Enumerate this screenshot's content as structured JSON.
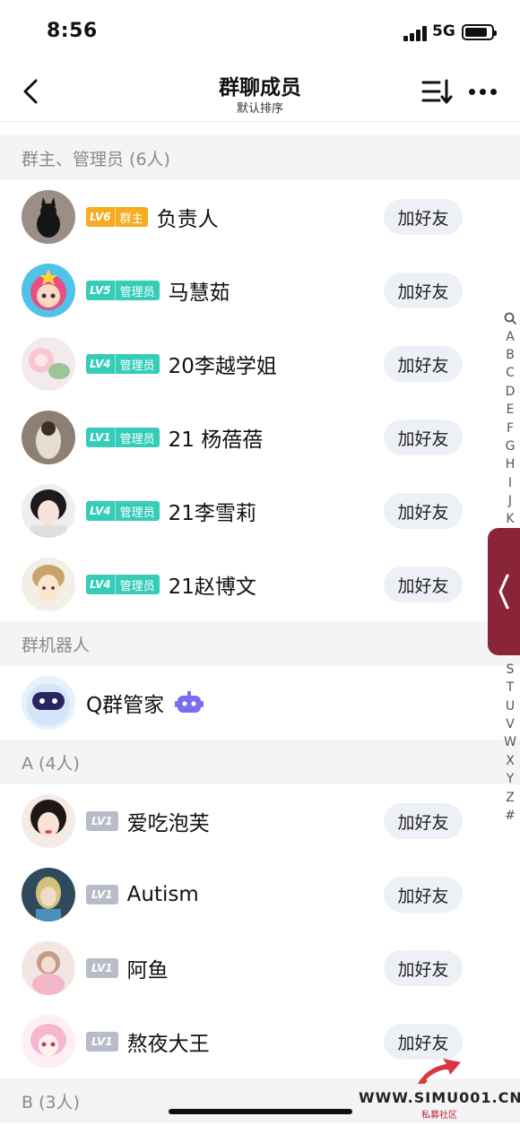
{
  "status_bar": {
    "time": "8:56",
    "network": "5G"
  },
  "nav": {
    "title": "群聊成员",
    "subtitle": "默认排序"
  },
  "sections": [
    {
      "header": "群主、管理员 (6人)",
      "members": [
        {
          "name": "负责人",
          "level": "LV6",
          "role": "群主",
          "role_type": "owner",
          "action": "加好友"
        },
        {
          "name": "马慧茹",
          "level": "LV5",
          "role": "管理员",
          "role_type": "admin",
          "action": "加好友"
        },
        {
          "name": "20李越学姐",
          "level": "LV4",
          "role": "管理员",
          "role_type": "admin",
          "action": "加好友"
        },
        {
          "name": "21 杨蓓蓓",
          "level": "LV1",
          "role": "管理员",
          "role_type": "admin",
          "action": "加好友"
        },
        {
          "name": "21李雪莉",
          "level": "LV4",
          "role": "管理员",
          "role_type": "admin",
          "action": "加好友"
        },
        {
          "name": "21赵博文",
          "level": "LV4",
          "role": "管理员",
          "role_type": "admin",
          "action": "加好友"
        }
      ]
    },
    {
      "header": "群机器人",
      "bot": {
        "name": "Q群管家"
      }
    },
    {
      "header": "A (4人)",
      "members": [
        {
          "name": "爱吃泡芙",
          "level": "LV1",
          "action": "加好友"
        },
        {
          "name": "Autism",
          "level": "LV1",
          "action": "加好友"
        },
        {
          "name": "阿鱼",
          "level": "LV1",
          "action": "加好友"
        },
        {
          "name": "熬夜大王",
          "level": "LV1",
          "action": "加好友"
        }
      ]
    },
    {
      "header": "B (3人)"
    }
  ],
  "index_bar": [
    "Q",
    "A",
    "B",
    "C",
    "D",
    "E",
    "F",
    "G",
    "H",
    "I",
    "J",
    "K",
    "S",
    "T",
    "U",
    "V",
    "W",
    "X",
    "Y",
    "Z",
    "#"
  ],
  "watermark": {
    "text": "WWW.SIMU001.CN",
    "sub": "私募社区"
  },
  "colors": {
    "owner_badge": "#f5ac21",
    "admin_badge": "#35cdb8",
    "plain_badge": "#b7bcc8",
    "side_handle": "#8a2539",
    "section_bg": "#f4f4f6"
  }
}
